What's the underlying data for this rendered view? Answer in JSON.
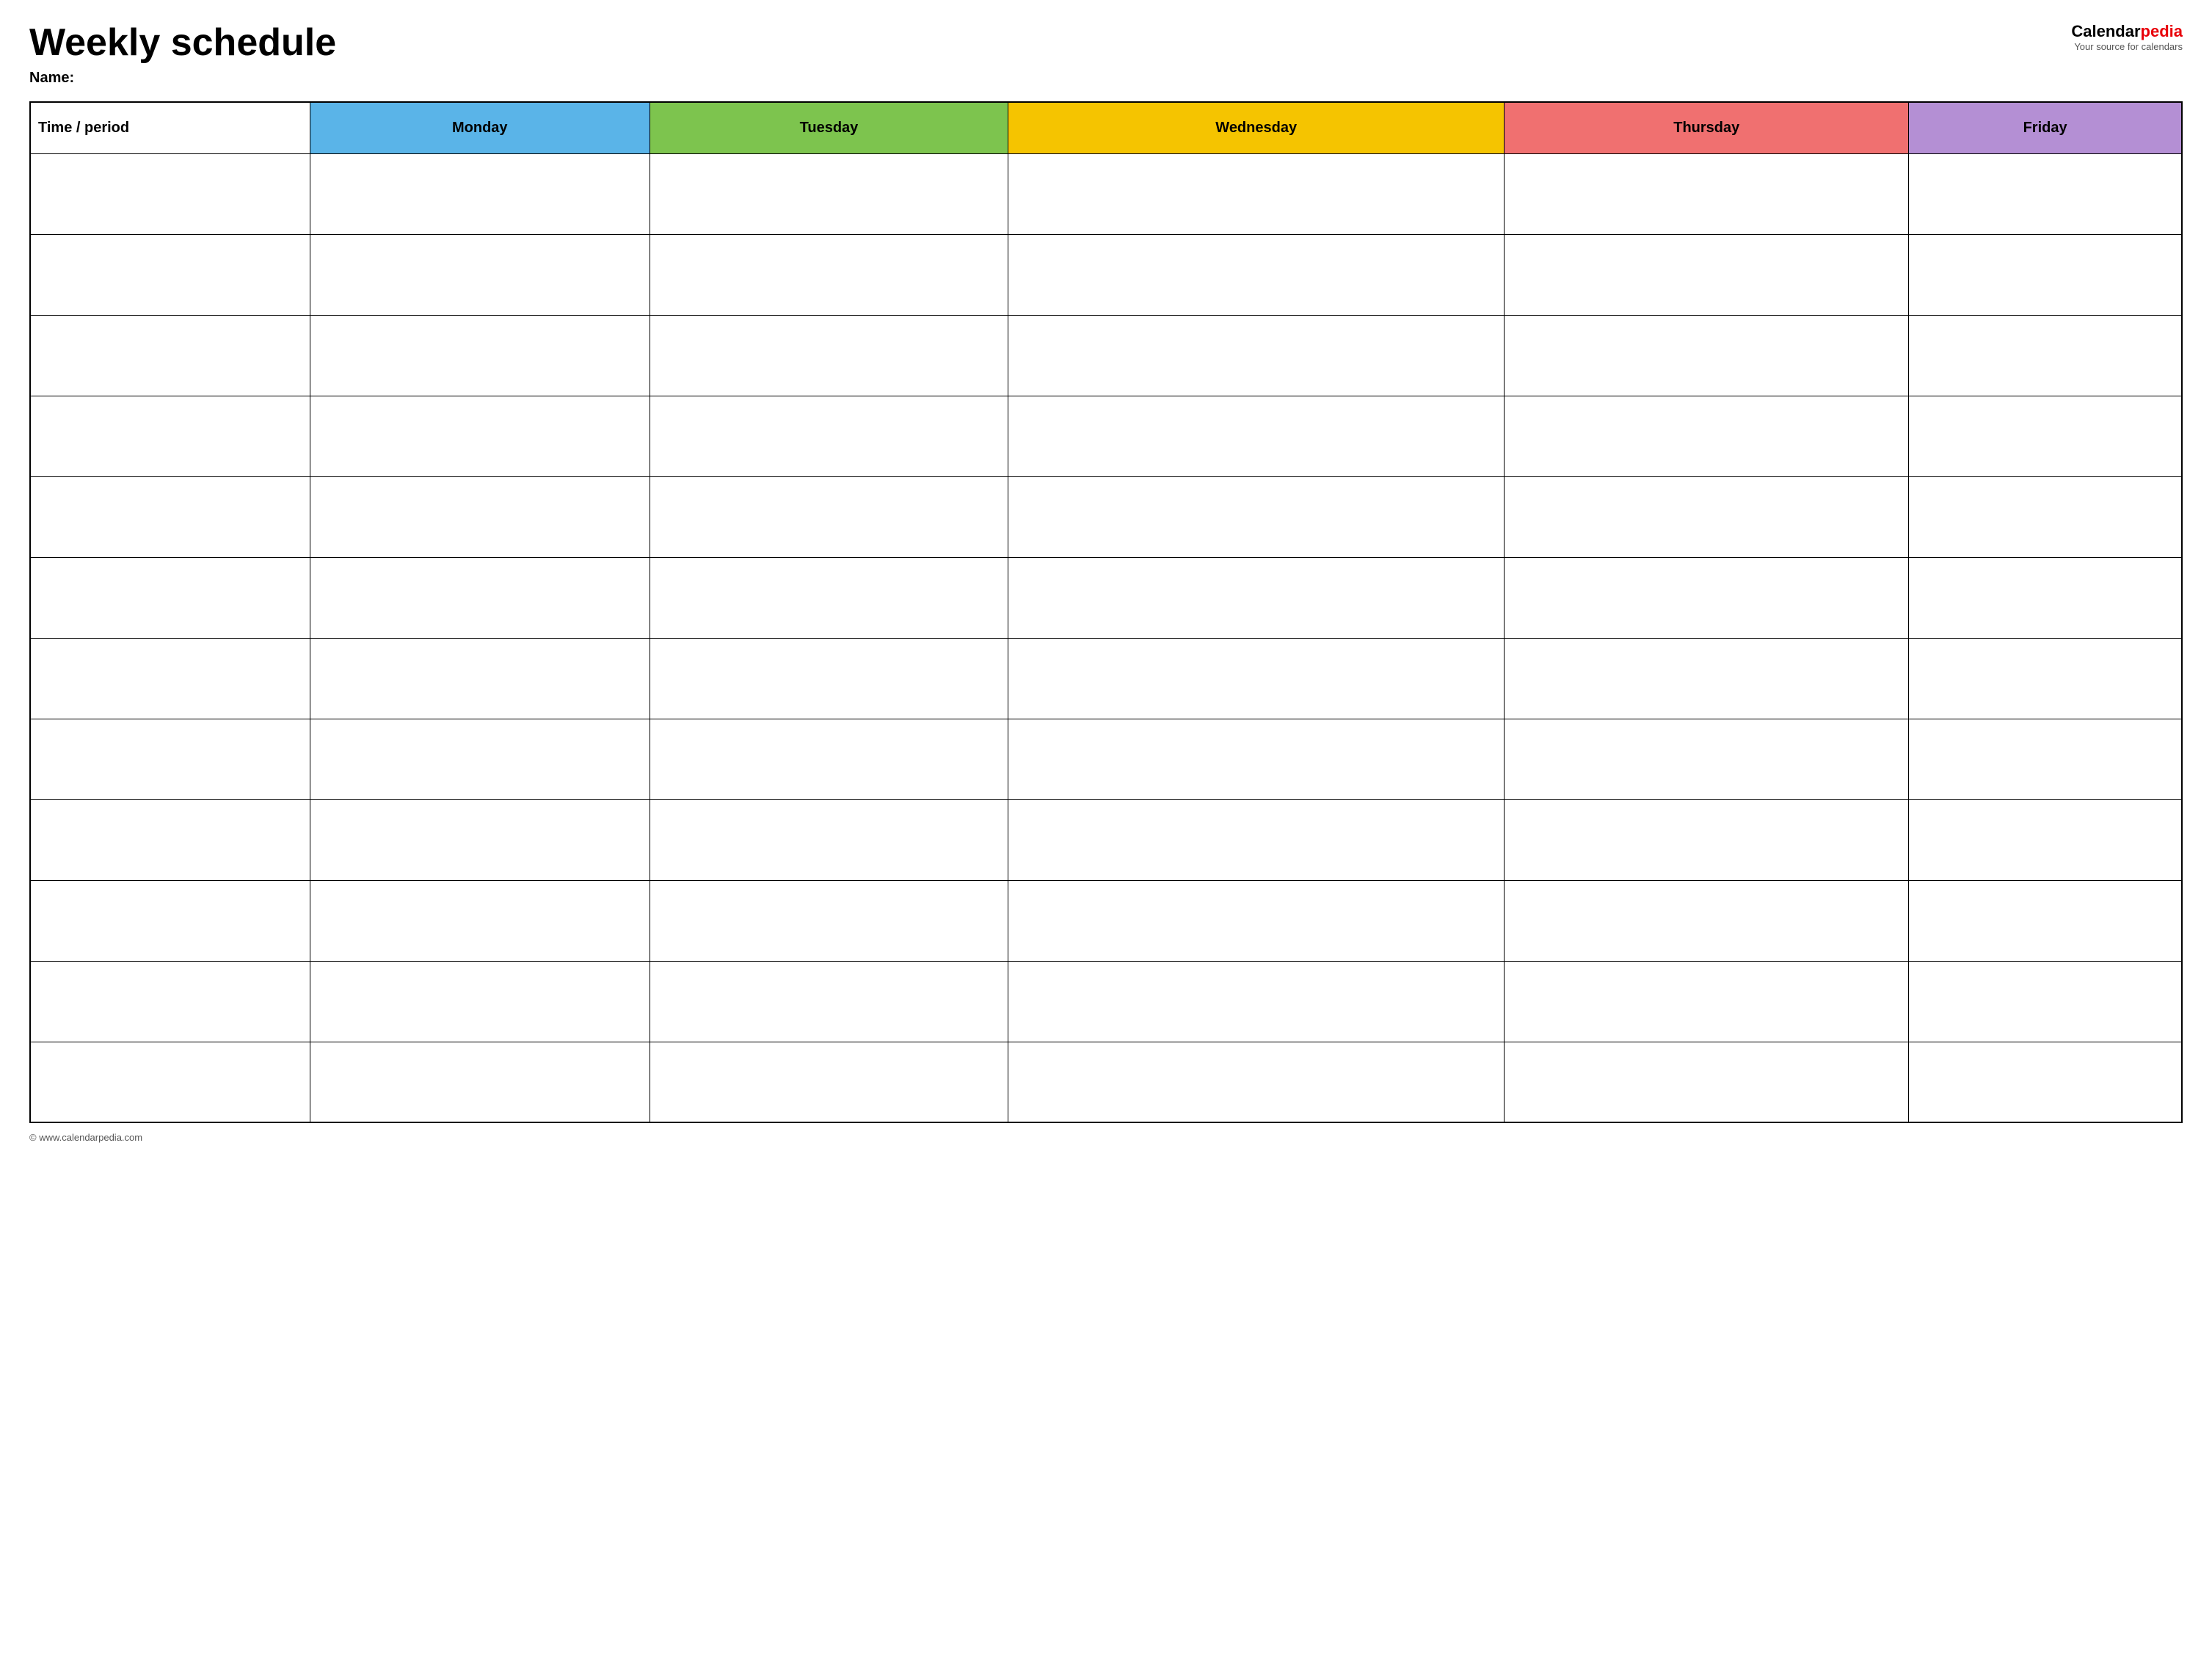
{
  "header": {
    "title": "Weekly schedule",
    "name_label": "Name:",
    "logo": {
      "calendar_text": "Calendar",
      "pedia_text": "pedia",
      "tagline": "Your source for calendars"
    }
  },
  "table": {
    "columns": [
      {
        "id": "time",
        "label": "Time / period",
        "class": "col-time"
      },
      {
        "id": "monday",
        "label": "Monday",
        "class": "col-monday"
      },
      {
        "id": "tuesday",
        "label": "Tuesday",
        "class": "col-tuesday"
      },
      {
        "id": "wednesday",
        "label": "Wednesday",
        "class": "col-wednesday"
      },
      {
        "id": "thursday",
        "label": "Thursday",
        "class": "col-thursday"
      },
      {
        "id": "friday",
        "label": "Friday",
        "class": "col-friday"
      }
    ],
    "row_count": 12
  },
  "footer": {
    "copyright": "© www.calendarpedia.com"
  }
}
